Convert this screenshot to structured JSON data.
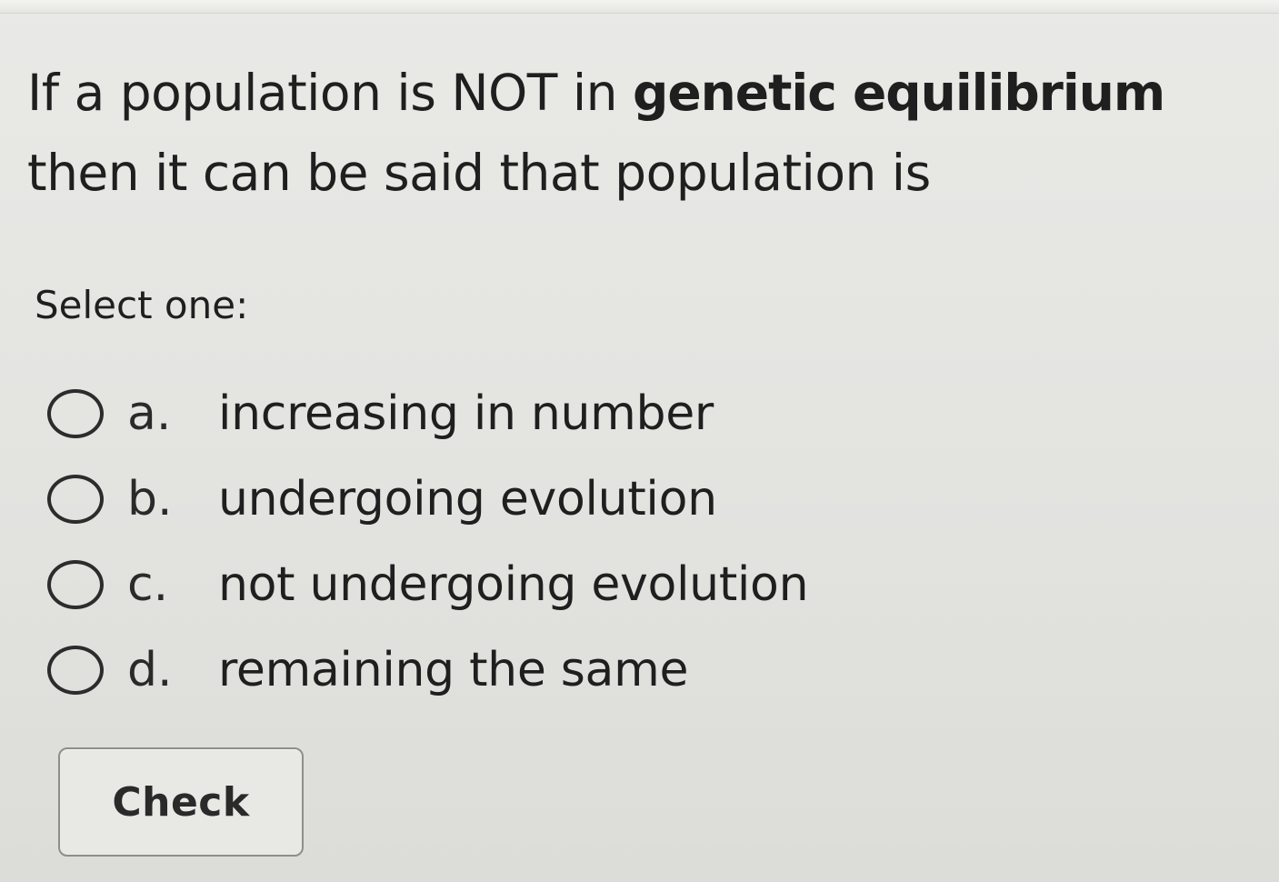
{
  "question": {
    "line1_before": "If a population is NOT in ",
    "line1_bold": "genetic equilibrium",
    "line2": "then it can be said that population is"
  },
  "select_label": "Select one:",
  "options": [
    {
      "letter": "a.",
      "text": "increasing in number",
      "selected": false
    },
    {
      "letter": "b.",
      "text": "undergoing evolution",
      "selected": false
    },
    {
      "letter": "c.",
      "text": "not undergoing evolution",
      "selected": false
    },
    {
      "letter": "d.",
      "text": "remaining the same",
      "selected": false
    }
  ],
  "check_button": {
    "label": "Check"
  }
}
